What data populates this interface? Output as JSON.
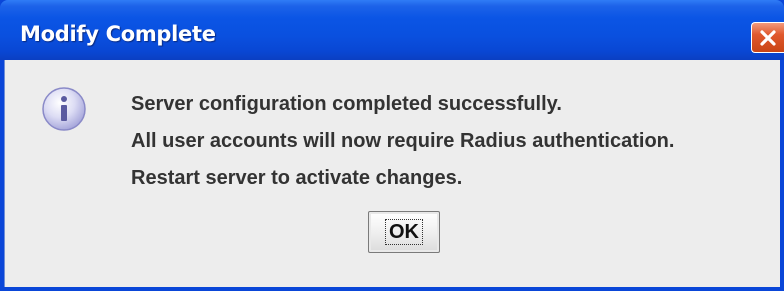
{
  "dialog": {
    "title": "Modify Complete",
    "close_icon": "close-icon",
    "icon": "info-icon",
    "messages": [
      "Server configuration completed successfully.",
      "All user accounts will now require Radius authentication.",
      "Restart server to activate changes."
    ],
    "ok_label": "OK"
  },
  "colors": {
    "titlebar": "#0a50df",
    "close_button": "#e0582d",
    "content_background": "#ededed",
    "text": "#333333"
  }
}
